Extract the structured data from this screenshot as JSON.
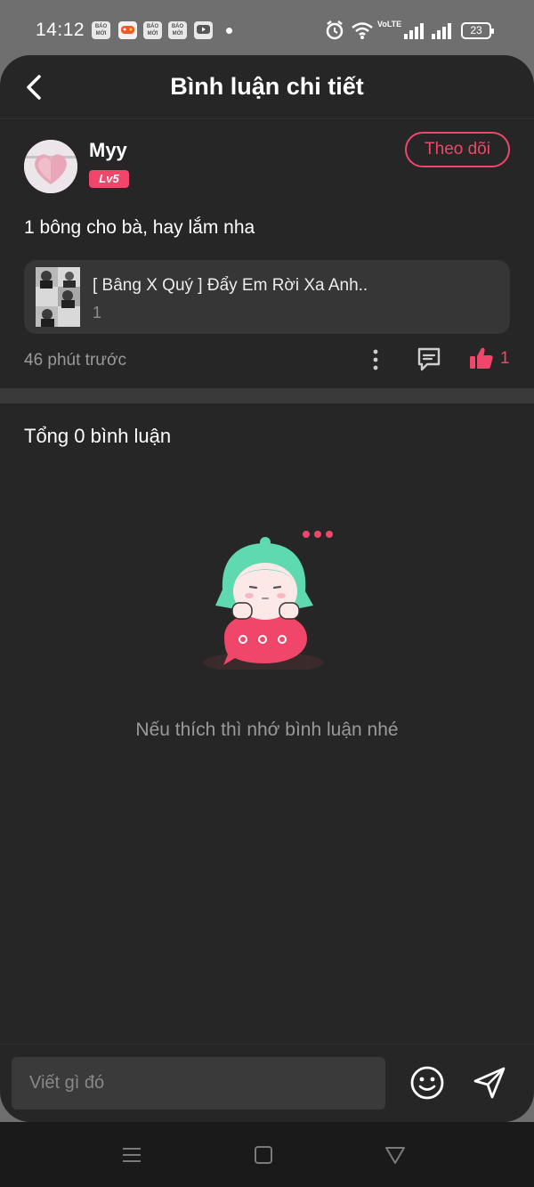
{
  "status_bar": {
    "time": "14:12",
    "app_icons": [
      "BÁO MỚI",
      "game-icon",
      "BÁO MỚI",
      "BÁO MỚI",
      "youtube-icon"
    ],
    "badge_text": "BÁO MỚI",
    "network_label": "VoLTE",
    "battery": "23"
  },
  "header": {
    "title": "Bình luận chi tiết"
  },
  "comment": {
    "user_name": "Myy",
    "level": "Lv5",
    "follow_label": "Theo dõi",
    "text": "1 bông cho bà, hay lắm nha",
    "song_title": "[ Bâng X Quý ] Đẩy Em Rời Xa Anh..",
    "song_count": "1",
    "time_ago": "46 phút trước",
    "like_count": "1"
  },
  "replies": {
    "total_label": "Tổng 0 bình luận",
    "empty_message": "Nếu thích thì nhớ bình luận nhé"
  },
  "composer": {
    "placeholder": "Viết gì đó"
  },
  "colors": {
    "accent": "#f0466a",
    "background": "#262626",
    "card": "#363636",
    "mint": "#5fd9b0"
  },
  "icons": {
    "back": "chevron-left-icon",
    "more": "more-vertical-icon",
    "reply": "comment-icon",
    "like": "thumbs-up-icon",
    "emoji": "smiley-icon",
    "send": "send-icon"
  }
}
